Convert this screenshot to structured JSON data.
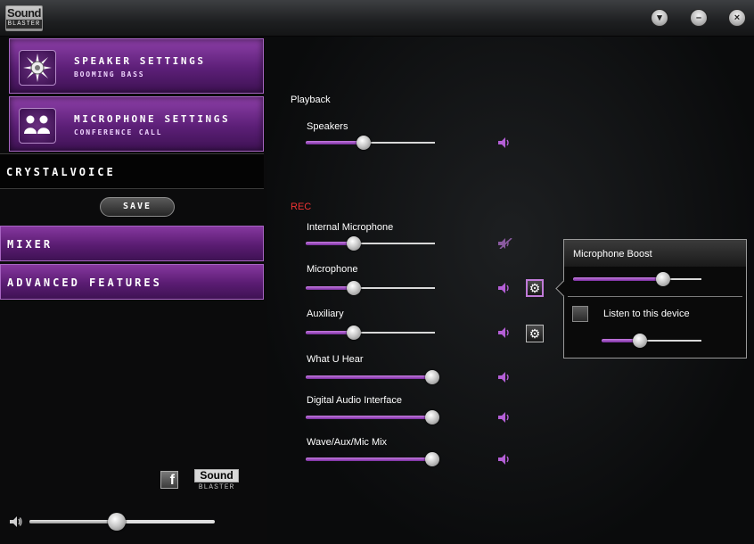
{
  "titlebar": {
    "logo_line1": "Sound",
    "logo_line2": "BLASTER",
    "buttons": [
      {
        "glyph": "▾",
        "name": "menu"
      },
      {
        "glyph": "–",
        "name": "minimize"
      },
      {
        "glyph": "×",
        "name": "close"
      }
    ]
  },
  "sidebar": {
    "speaker_settings": {
      "title": "SPEAKER SETTINGS",
      "subtitle": "BOOMING BASS"
    },
    "microphone_settings": {
      "title": "MICROPHONE SETTINGS",
      "subtitle": "CONFERENCE CALL"
    },
    "crystalvoice_label": "CRYSTALVOICE",
    "save_label": "SAVE",
    "mixer_label": "MIXER",
    "advanced_label": "ADVANCED FEATURES",
    "facebook_glyph": "f",
    "footer_logo_line1": "Sound",
    "footer_logo_line2": "BLASTER",
    "master_volume": 0.47
  },
  "main": {
    "playback_label": "Playback",
    "playback_channels": [
      {
        "label": "Speakers",
        "value": 0.45,
        "muted": false
      }
    ],
    "rec_label": "REC",
    "rec_channels": [
      {
        "label": "Internal Microphone",
        "value": 0.37,
        "muted": true,
        "gear": false
      },
      {
        "label": "Microphone",
        "value": 0.37,
        "muted": false,
        "gear": true,
        "gear_selected": true
      },
      {
        "label": "Auxiliary",
        "value": 0.37,
        "muted": false,
        "gear": true,
        "gear_selected": false
      },
      {
        "label": "What U Hear",
        "value": 0.98,
        "muted": false,
        "gear": false
      },
      {
        "label": "Digital Audio Interface",
        "value": 0.98,
        "muted": false,
        "gear": false
      },
      {
        "label": "Wave/Aux/Mic Mix",
        "value": 0.98,
        "muted": false,
        "gear": false
      }
    ]
  },
  "popup": {
    "boost_label": "Microphone Boost",
    "boost_value": 0.7,
    "listen_label": "Listen to this device",
    "listen_checked": false,
    "listen_value": 0.38
  },
  "colors": {
    "accent": "#8d3fa8",
    "accent_light": "#c57be0",
    "rec_red": "#e33333",
    "speaker_icon": "#b45fd6",
    "muted_icon": "#8a5aa0"
  }
}
